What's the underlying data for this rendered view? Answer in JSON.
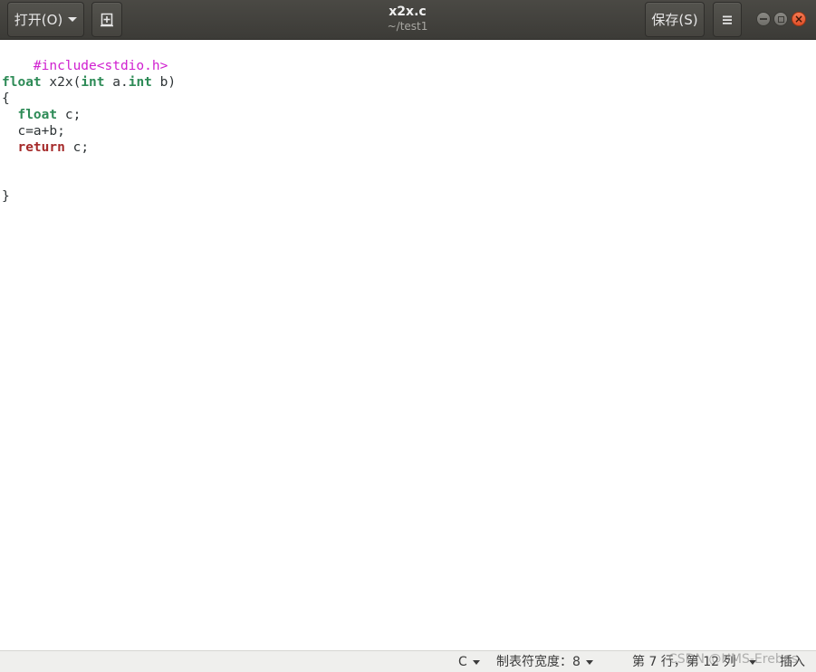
{
  "header": {
    "open_label": "打开(O)",
    "save_label": "保存(S)",
    "title": "x2x.c",
    "subtitle": "~/test1",
    "icons": {
      "open_dropdown": "chevron-down-icon",
      "new_tab": "new-document-icon",
      "menu": "hamburger-menu-icon",
      "minimize": "minimize-icon",
      "maximize": "maximize-icon",
      "close": "close-icon"
    }
  },
  "editor": {
    "line1": {
      "pre": "#include<stdio.h>"
    },
    "line3": {
      "t1": "float",
      "t2": " x2x(",
      "t3": "int",
      "t4": " a.",
      "t5": "int",
      "t6": " b)"
    },
    "line4": {
      "t1": "{"
    },
    "line5": {
      "t1": "  ",
      "t2": "float",
      "t3": " c;"
    },
    "line6": {
      "t1": "  c=a+b;"
    },
    "line7": {
      "t1": "  ",
      "t2": "return",
      "t3": " c;"
    },
    "line10": {
      "t1": "}"
    }
  },
  "statusbar": {
    "language": "C",
    "tab_width": "制表符宽度：8",
    "cursor_position": "第 7 行，第 12 列",
    "insert_mode": "插入",
    "watermark": "CSDN @HMS-Erebus"
  },
  "colors": {
    "header_bg": "#3c3b37",
    "type_keyword": "#2e8b57",
    "return_keyword": "#a52a2a",
    "preprocessor": "#d020d0",
    "close_button": "#e95420"
  }
}
